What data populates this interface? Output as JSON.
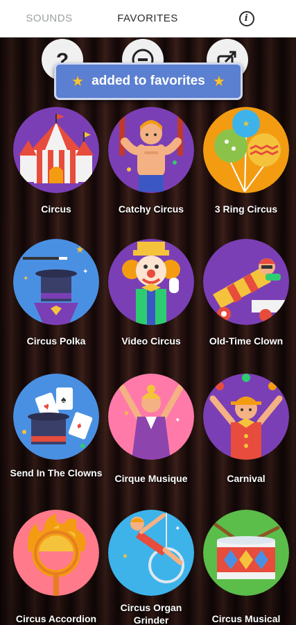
{
  "tabs": {
    "sounds": "SOUNDS",
    "favorites": "FAVORITES",
    "info_glyph": "i"
  },
  "toast": {
    "text": "added to favorites",
    "star_icon": "star-icon"
  },
  "top_buttons": [
    {
      "icon": "help-icon"
    },
    {
      "icon": "stop-icon"
    },
    {
      "icon": "share-icon"
    }
  ],
  "sounds": [
    {
      "label": "Circus",
      "icon": "circus-tent-icon",
      "color": "#7b3fb5"
    },
    {
      "label": "Catchy Circus",
      "icon": "strongman-icon",
      "color": "#7b3fb5"
    },
    {
      "label": "3 Ring Circus",
      "icon": "balloons-icon",
      "color": "#f39c12"
    },
    {
      "label": "Circus Polka",
      "icon": "magic-hat-icon",
      "color": "#4a90e2"
    },
    {
      "label": "Video Circus",
      "icon": "clown-icon",
      "color": "#7b3fb5"
    },
    {
      "label": "Old-Time Clown",
      "icon": "cannon-icon",
      "color": "#7b3fb5"
    },
    {
      "label": "Send In The Clowns",
      "icon": "magic-cards-icon",
      "color": "#4a90e2"
    },
    {
      "label": "Cirque Musique",
      "icon": "acrobat-icon",
      "color": "#ff7aa8"
    },
    {
      "label": "Carnival",
      "icon": "juggler-icon",
      "color": "#7b3fb5"
    },
    {
      "label": "Circus Accordion",
      "icon": "ring-of-fire-icon",
      "color": "#ff7a8a"
    },
    {
      "label": "Circus Organ Grinder",
      "icon": "aerialist-icon",
      "color": "#3db3ea"
    },
    {
      "label": "Circus Musical",
      "icon": "drum-icon",
      "color": "#5bbd4a"
    }
  ]
}
